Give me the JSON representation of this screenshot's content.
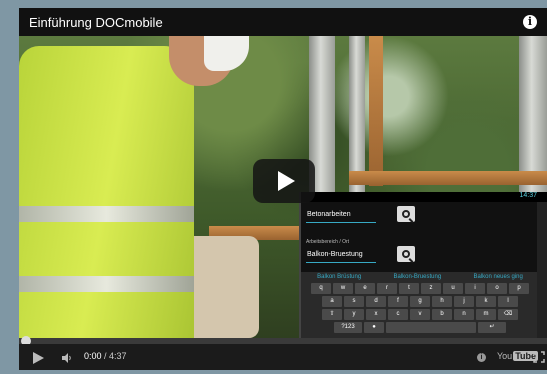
{
  "player": {
    "title": "Einführung DOCmobile",
    "current_time": "0:00",
    "duration": "/ 4:37",
    "progress_fraction": 0.0,
    "youtube_logo_left": "You",
    "youtube_logo_right": "Tube"
  },
  "phone": {
    "clock": "14:37",
    "field1": "Betonarbeiten",
    "subtitle": "Arbeitsbereich / Ort",
    "field2": "Balkon-Bruestung",
    "suggestions": [
      "Balkon Brüstung",
      "Balkon-Bruestung",
      "Balkon neues ging"
    ],
    "rows": [
      [
        "q",
        "w",
        "e",
        "r",
        "t",
        "z",
        "u",
        "i",
        "o",
        "p"
      ],
      [
        "a",
        "s",
        "d",
        "f",
        "g",
        "h",
        "j",
        "k",
        "l"
      ],
      [
        "⇧",
        "y",
        "x",
        "c",
        "v",
        "b",
        "n",
        "m",
        "⌫"
      ]
    ],
    "bottom_left": "?123",
    "bottom_right": "↵"
  },
  "colors": {
    "accent": "#37a9c4",
    "vest": "#d9ec52"
  }
}
